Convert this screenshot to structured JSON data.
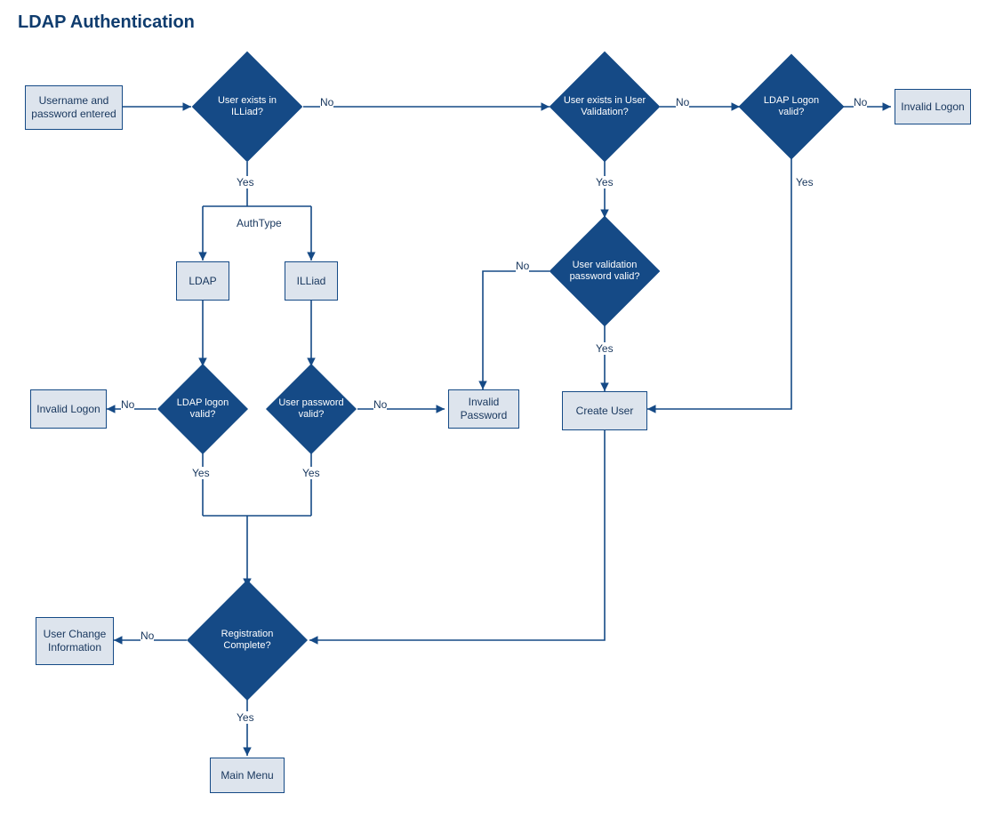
{
  "title": "LDAP Authentication",
  "nodes": {
    "start": "Username and password entered",
    "d_exists_illiad": "User exists in ILLiad?",
    "d_exists_validation": "User exists in User Validation?",
    "d_ldap_logon_valid2": "LDAP Logon valid?",
    "invalid_logon_right": "Invalid Logon",
    "authtype_label": "AuthType",
    "ldap_box": "LDAP",
    "illiad_box": "ILLiad",
    "d_user_val_pw": "User validation password valid?",
    "d_ldap_logon_valid1": "LDAP logon valid?",
    "d_user_pw_valid": "User password valid?",
    "invalid_logon_left": "Invalid Logon",
    "invalid_password": "Invalid Password",
    "create_user": "Create User",
    "d_reg_complete": "Registration Complete?",
    "user_change_info": "User Change Information",
    "main_menu": "Main Menu"
  },
  "edges": {
    "yes": "Yes",
    "no": "No"
  }
}
